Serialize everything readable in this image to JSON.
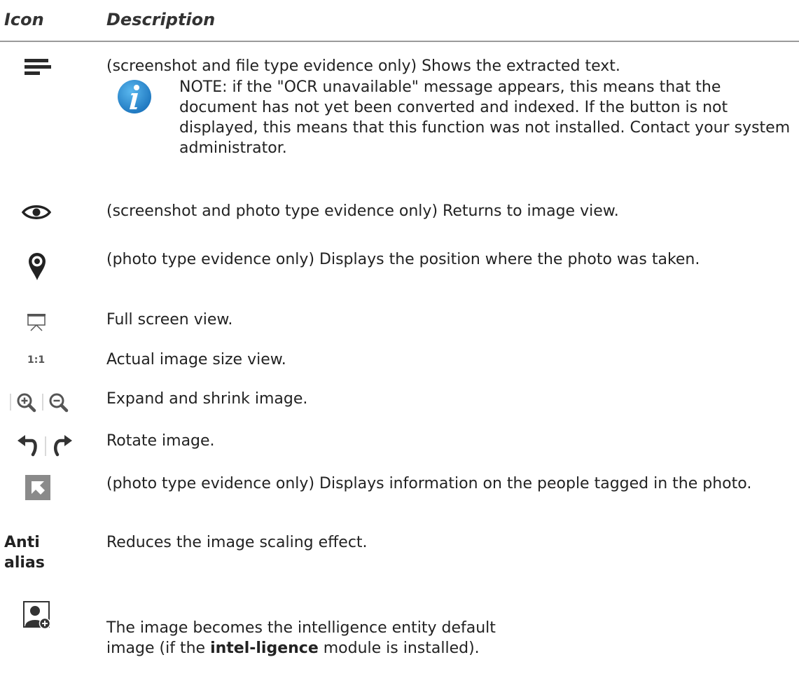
{
  "table": {
    "header": {
      "icon": "Icon",
      "description": "Description"
    },
    "rows": [
      {
        "icon": "extracted-text-icon",
        "description": "(screenshot and file type evidence only) Shows the extracted text."
      },
      {
        "icon": "eye-icon",
        "description": "(screenshot and photo type evidence only) Returns to image view."
      },
      {
        "icon": "map-pin-icon",
        "description": "(photo type evidence only) Displays the position where the photo was taken."
      },
      {
        "icon": "projector-screen-icon",
        "description": "Full screen view."
      },
      {
        "icon": "actual-size-icon",
        "icon_text": "1:1",
        "description": "Actual image size view."
      },
      {
        "icon": "zoom-in-out-icons",
        "description": "Expand and shrink image."
      },
      {
        "icon": "rotate-icons",
        "description": "Rotate image."
      },
      {
        "icon": "tagged-people-icon",
        "description": "(photo type evidence only) Displays information on the people tagged in the photo."
      },
      {
        "icon": "antialias-label",
        "icon_text": "Anti alias",
        "description": "Reduces the image scaling effect."
      },
      {
        "icon": "entity-image-icon",
        "description_before": "The image becomes the intelligence entity default image (if the ",
        "description_bold": "intel-ligence",
        "description_after": " module is installed)."
      }
    ],
    "note": {
      "icon": "info-icon",
      "text": "NOTE: if the \"OCR unavailable\" message appears, this means that the document has not yet been converted and indexed. If the button is not displayed, this means that this function was not installed. Contact your system administrator."
    }
  }
}
